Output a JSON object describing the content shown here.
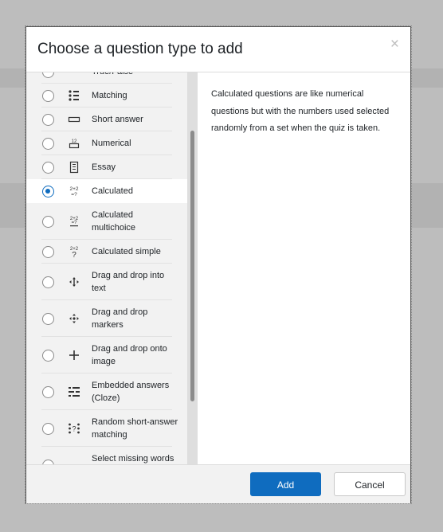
{
  "dialog": {
    "title": "Choose a question type to add",
    "close_symbol": "×"
  },
  "options": [
    {
      "label": "True/False",
      "icon": "truefalse-icon",
      "selected": false
    },
    {
      "label": "Matching",
      "icon": "matching-icon",
      "selected": false
    },
    {
      "label": "Short answer",
      "icon": "short-answer-icon",
      "selected": false
    },
    {
      "label": "Numerical",
      "icon": "numerical-icon",
      "selected": false
    },
    {
      "label": "Essay",
      "icon": "essay-icon",
      "selected": false
    },
    {
      "label": "Calculated",
      "icon": "calculated-icon",
      "selected": true
    },
    {
      "label": "Calculated multichoice",
      "icon": "calculated-multichoice-icon",
      "selected": false
    },
    {
      "label": "Calculated simple",
      "icon": "calculated-simple-icon",
      "selected": false
    },
    {
      "label": "Drag and drop into text",
      "icon": "drag-drop-text-icon",
      "selected": false
    },
    {
      "label": "Drag and drop markers",
      "icon": "drag-drop-markers-icon",
      "selected": false
    },
    {
      "label": "Drag and drop onto image",
      "icon": "drag-drop-image-icon",
      "selected": false
    },
    {
      "label": "Embedded answers (Cloze)",
      "icon": "cloze-icon",
      "selected": false
    },
    {
      "label": "Random short-answer matching",
      "icon": "random-matching-icon",
      "selected": false
    },
    {
      "label": "Select missing words",
      "icon": "select-missing-words-icon",
      "selected": false
    }
  ],
  "description": "Calculated questions are like numerical questions but with the numbers used selected randomly from a set when the quiz is taken.",
  "footer": {
    "add_label": "Add",
    "cancel_label": "Cancel"
  },
  "colors": {
    "accent": "#0f6cbf",
    "overlay": "#bdbdbd",
    "list_background": "#f2f2f2"
  }
}
